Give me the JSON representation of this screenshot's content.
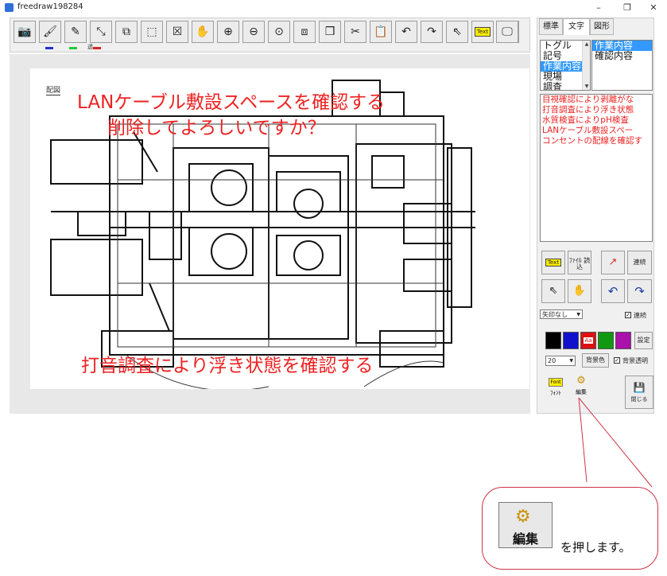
{
  "window": {
    "title": "freedraw198284",
    "minimize": "–",
    "maximize": "❐",
    "close": "✕"
  },
  "toolbar": {
    "buttons": [
      {
        "name": "camera-icon",
        "glyph": "📷"
      },
      {
        "name": "brush-icon",
        "glyph": "🖌"
      },
      {
        "name": "pen-icon",
        "glyph": "✎"
      },
      {
        "name": "resize-arrow-icon",
        "glyph": "⤡"
      },
      {
        "name": "paste-icon",
        "glyph": "⧉"
      },
      {
        "name": "select-arrange-icon",
        "glyph": "⬚"
      },
      {
        "name": "delete-x-icon",
        "glyph": "☒"
      },
      {
        "name": "hand-icon",
        "glyph": "✋"
      },
      {
        "name": "zoom-in-icon",
        "glyph": "⊕"
      },
      {
        "name": "zoom-out-icon",
        "glyph": "⊖"
      },
      {
        "name": "zoom-fit-icon",
        "glyph": "⊙"
      },
      {
        "name": "copy-icon",
        "glyph": "⧈"
      },
      {
        "name": "stack-icon",
        "glyph": "❒"
      },
      {
        "name": "scissors-icon",
        "glyph": "✂"
      },
      {
        "name": "clipboard-icon",
        "glyph": "📋"
      },
      {
        "name": "undo-icon",
        "glyph": "↶"
      },
      {
        "name": "redo-icon",
        "glyph": "↷"
      },
      {
        "name": "pointer-icon",
        "glyph": "⇖"
      },
      {
        "name": "text-tool-icon",
        "label": "Text"
      },
      {
        "name": "menu-icon",
        "label": "Menu"
      },
      {
        "name": "screen-capture-icon",
        "glyph": "🖵"
      }
    ],
    "trans_label": "透",
    "colors": {
      "blue": "#2233cc",
      "green": "#22cc33",
      "red": "#dd2222"
    }
  },
  "canvas": {
    "corner_label": "配図",
    "texts": [
      "LANケーブル敷設スペースを確認する",
      "削除してよろしいですか？",
      "打音調査により浮き状態を確認する"
    ]
  },
  "right_panel": {
    "tabs": [
      "標準",
      "文字",
      "図形"
    ],
    "category_list": [
      "トグル",
      "記号",
      "作業内容",
      "現場",
      "調査"
    ],
    "sub_list": [
      "作業内容",
      "確認内容"
    ],
    "log_lines": [
      "目視確認により剥離がな",
      "打音調査により浮き状態",
      "水質検査によりpH検査",
      "LANケーブル敷設スペー",
      "コンセントの配線を確認す"
    ],
    "text_button": "Text",
    "file_load_button": "ﾌｧｲﾙ 読込",
    "continuous_button": "連続",
    "arrow_select": "矢印なし",
    "continuous_check": "連続",
    "setting_button": "設定",
    "font_size": "20",
    "bg_color_button": "背景色",
    "bg_transparent": "背景透明",
    "font_label": "ﾌｫﾝﾄ",
    "font_icon_text": "Font",
    "edit_label": "編集",
    "close_label": "閉じる",
    "swatch_colors": [
      "#000000",
      "#1111cc",
      "#dd1111",
      "#119911",
      "#aa11aa"
    ],
    "swatch_red_text": "Aa"
  },
  "callout": {
    "button_label": "編集",
    "instruction": "を押します。"
  }
}
